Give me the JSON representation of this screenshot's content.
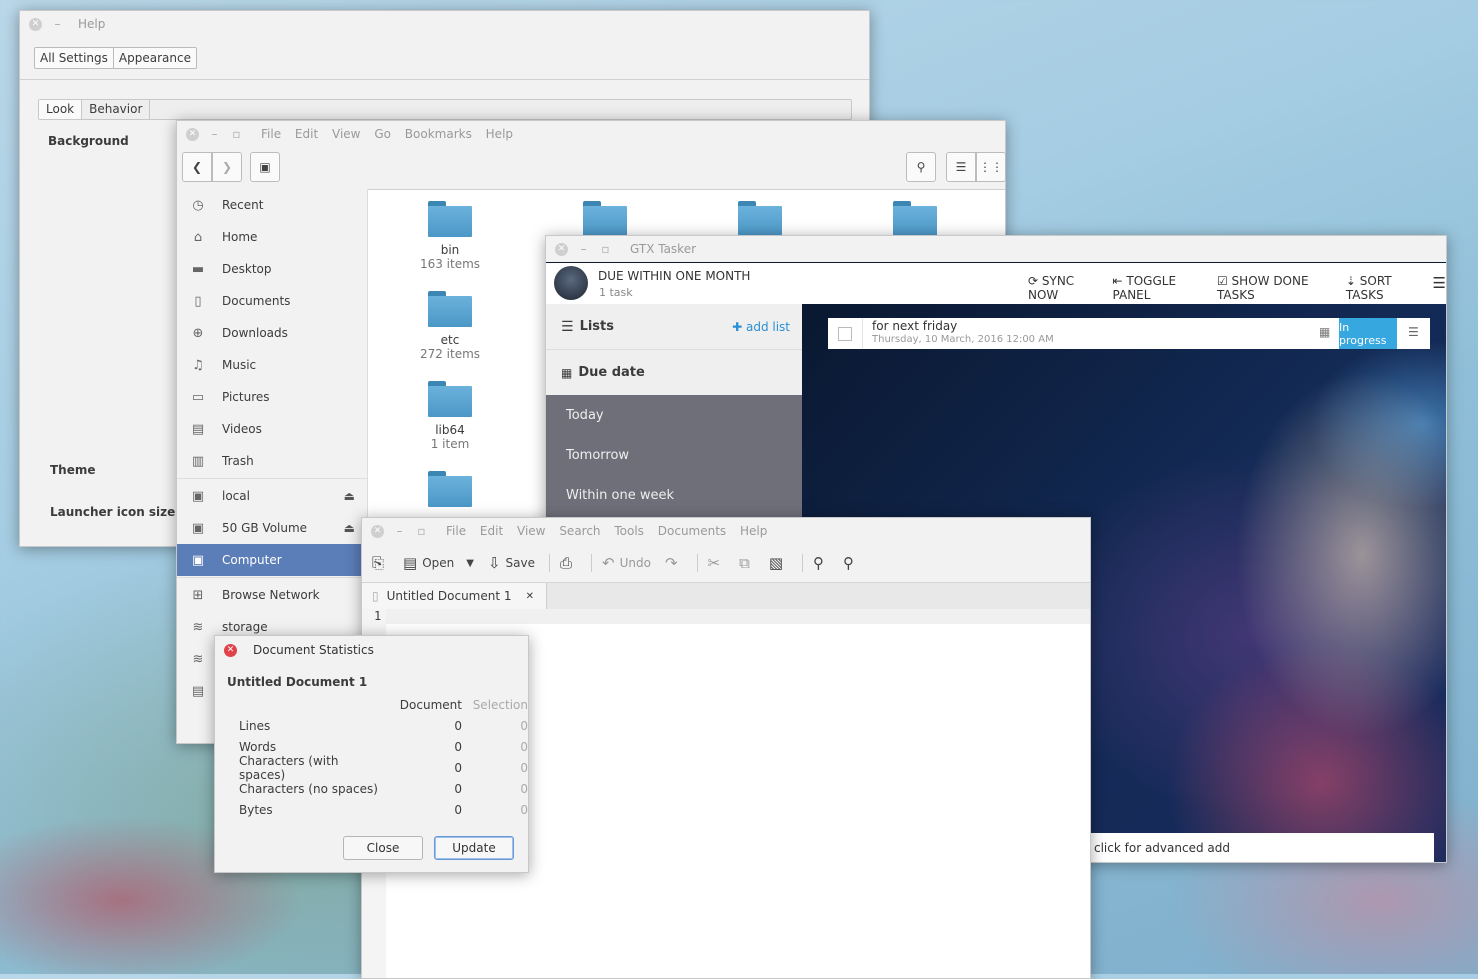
{
  "settings": {
    "title": "Help",
    "tabs_top": [
      "All Settings",
      "Appearance"
    ],
    "tabs": [
      "Look",
      "Behavior"
    ],
    "labels": {
      "background": "Background",
      "theme": "Theme",
      "launcher": "Launcher icon size"
    }
  },
  "files": {
    "menu": [
      "File",
      "Edit",
      "View",
      "Go",
      "Bookmarks",
      "Help"
    ],
    "sidebar": [
      {
        "icon": "clock-icon",
        "label": "Recent"
      },
      {
        "icon": "home-icon",
        "label": "Home"
      },
      {
        "icon": "folder-icon",
        "label": "Desktop"
      },
      {
        "icon": "document-icon",
        "label": "Documents"
      },
      {
        "icon": "download-icon",
        "label": "Downloads"
      },
      {
        "icon": "music-icon",
        "label": "Music"
      },
      {
        "icon": "pictures-icon",
        "label": "Pictures"
      },
      {
        "icon": "video-icon",
        "label": "Videos"
      },
      {
        "icon": "trash-icon",
        "label": "Trash"
      },
      {
        "icon": "drive-icon",
        "label": "local"
      },
      {
        "icon": "drive-icon",
        "label": "50 GB Volume"
      },
      {
        "icon": "drive-icon",
        "label": "Computer"
      },
      {
        "icon": "network-icon",
        "label": "Browse Network"
      },
      {
        "icon": "wifi-icon",
        "label": "storage"
      }
    ],
    "folders": [
      {
        "name": "bin",
        "count": "163 items"
      },
      {
        "name": "etc",
        "count": "272 items"
      },
      {
        "name": "lib64",
        "count": "1 item"
      }
    ]
  },
  "tasker": {
    "title": "GTX Tasker",
    "header": {
      "heading": "DUE WITHIN ONE MONTH",
      "count": "1 task"
    },
    "actions": [
      "SYNC NOW",
      "TOGGLE PANEL",
      "SHOW DONE TASKS",
      "SORT TASKS"
    ],
    "lists_label": "Lists",
    "add_list": "add list",
    "due_label": "Due date",
    "due_items": [
      "Today",
      "Tomorrow",
      "Within one week"
    ],
    "task": {
      "title": "for next friday",
      "date": "Thursday, 10 March, 2016 12:00 AM",
      "status": "In progress"
    },
    "advanced": "click for advanced add"
  },
  "editor": {
    "menu": [
      "File",
      "Edit",
      "View",
      "Search",
      "Tools",
      "Documents",
      "Help"
    ],
    "toolbar": {
      "open": "Open",
      "save": "Save",
      "undo": "Undo"
    },
    "tab": "Untitled Document 1",
    "line": "1"
  },
  "stats": {
    "title": "Document Statistics",
    "doc": "Untitled Document 1",
    "col_doc": "Document",
    "col_sel": "Selection",
    "rows": [
      {
        "label": "Lines",
        "doc": "0",
        "sel": "0"
      },
      {
        "label": "Words",
        "doc": "0",
        "sel": "0"
      },
      {
        "label": "Characters (with spaces)",
        "doc": "0",
        "sel": "0"
      },
      {
        "label": "Characters (no spaces)",
        "doc": "0",
        "sel": "0"
      },
      {
        "label": "Bytes",
        "doc": "0",
        "sel": "0"
      }
    ],
    "close": "Close",
    "update": "Update"
  }
}
